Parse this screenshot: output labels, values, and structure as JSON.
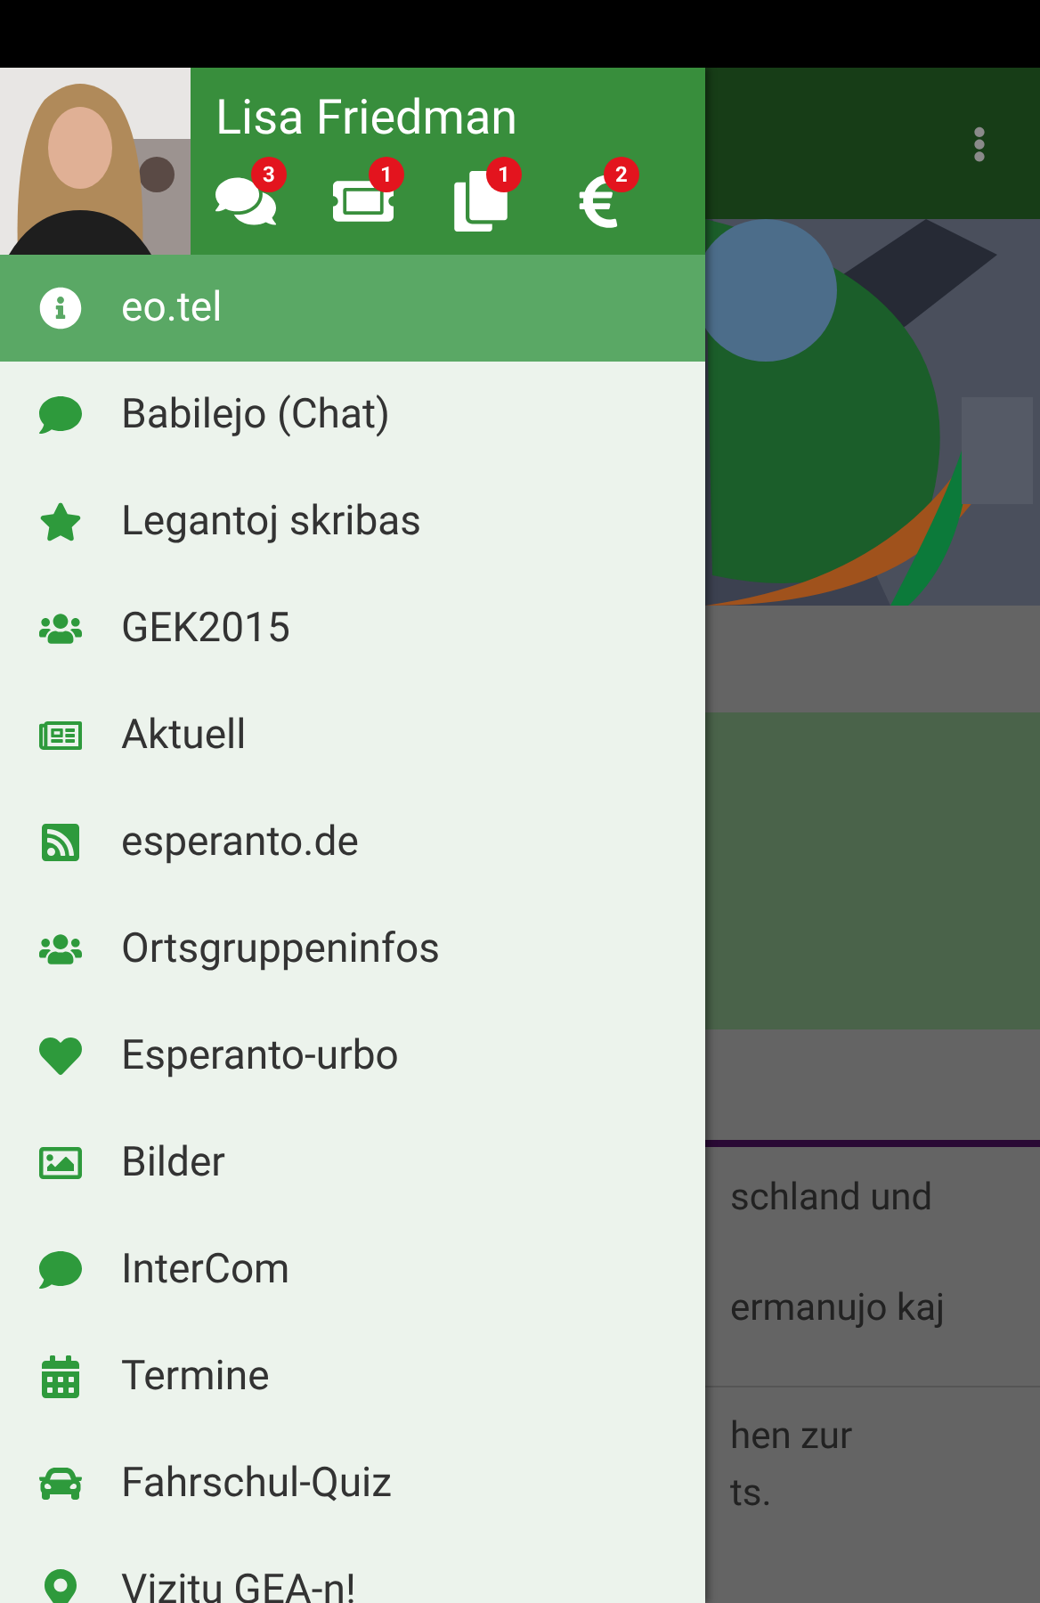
{
  "drawer": {
    "user_name": "Lisa Friedman",
    "counters": [
      {
        "badge": "3"
      },
      {
        "badge": "1"
      },
      {
        "badge": "1"
      },
      {
        "badge": "2"
      }
    ],
    "items": [
      {
        "label": "eo.tel",
        "selected": true
      },
      {
        "label": "Babilejo (Chat)",
        "selected": false
      },
      {
        "label": "Legantoj skribas",
        "selected": false
      },
      {
        "label": "GEK2015",
        "selected": false
      },
      {
        "label": "Aktuell",
        "selected": false
      },
      {
        "label": "esperanto.de",
        "selected": false
      },
      {
        "label": "Ortsgruppeninfos",
        "selected": false
      },
      {
        "label": "Esperanto-urbo",
        "selected": false
      },
      {
        "label": "Bilder",
        "selected": false
      },
      {
        "label": "InterCom",
        "selected": false
      },
      {
        "label": "Termine",
        "selected": false
      },
      {
        "label": "Fahrschul-Quiz",
        "selected": false
      },
      {
        "label": "Vizitu GEA-n!",
        "selected": false
      }
    ]
  },
  "background": {
    "lines": [
      "schland und",
      "ermanujo kaj",
      "hen zur",
      "ts."
    ]
  }
}
